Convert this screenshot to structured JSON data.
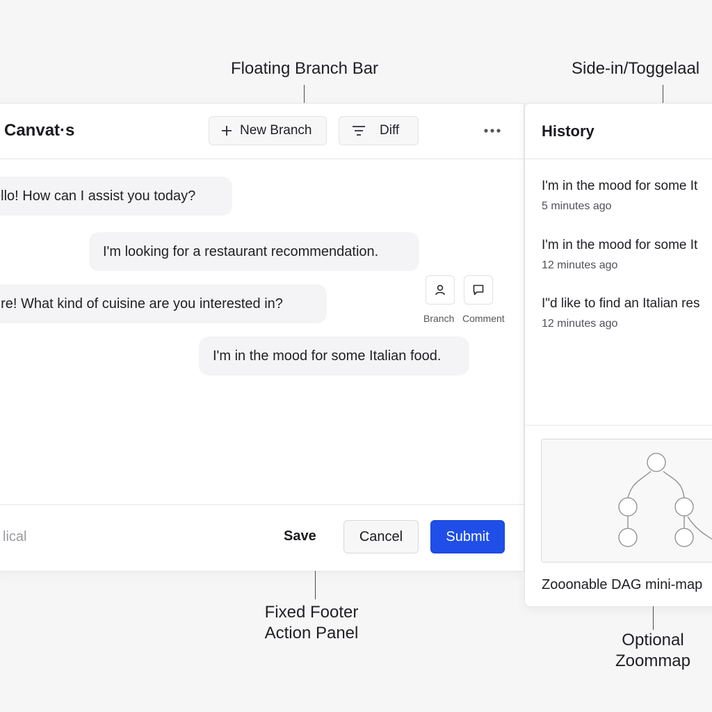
{
  "annotations": {
    "branch_bar": "Floating Branch Bar",
    "side_panel": "Side-in/Toggelaal",
    "footer_line1": "Fixed Footer",
    "footer_line2": "Action Panel",
    "zoommap_line1": "Optional",
    "zoommap_line2": "Zoommap"
  },
  "header": {
    "title": "Canvat·s",
    "new_branch_label": "New Branch",
    "diff_label": "Diff",
    "more_icon": "more-horizontal-icon"
  },
  "messages": [
    {
      "role": "assistant",
      "text": "ello! How can I assist you today?"
    },
    {
      "role": "user",
      "text": "I'm looking for a restaurant recommendation."
    },
    {
      "role": "assistant",
      "text": "ure!  What kind of cuisine are you interested in?"
    },
    {
      "role": "user",
      "text": "I'm in the mood for some Italian food."
    }
  ],
  "message_actions": {
    "branch_label": "Branch",
    "comment_label": "Comment",
    "branch_icon": "person-icon",
    "comment_icon": "speech-bubble-icon"
  },
  "footer": {
    "input_placeholder": "lical",
    "save_label": "Save",
    "cancel_label": "Cancel",
    "submit_label": "Submit"
  },
  "history": {
    "title": "History",
    "items": [
      {
        "text": "I'm in the mood for some It",
        "time": "5 minutes ago"
      },
      {
        "text": "I'm in the mood for some It",
        "time": "12 minutes ago"
      },
      {
        "text": "I\"d like to find an Italian res",
        "time": "12 minutes ago"
      }
    ]
  },
  "minimap": {
    "caption": "Zooonable DAG mini-map"
  },
  "colors": {
    "accent": "#1f4fe8",
    "bubble": "#f4f4f6",
    "background": "#f6f6f7"
  }
}
